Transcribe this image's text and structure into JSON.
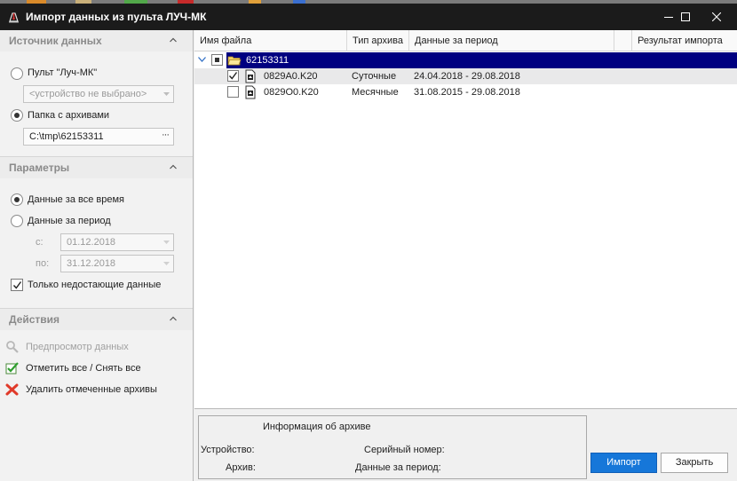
{
  "window": {
    "title": "Импорт данных из пульта ЛУЧ-МК",
    "icon": "pen-tool-icon",
    "controls": [
      "minimize-icon",
      "maximize-icon",
      "close-icon"
    ]
  },
  "left_panel": {
    "source": {
      "title": "Источник данных",
      "option_console_label": "Пульт \"Луч-МК\"",
      "option_console_checked": false,
      "device_placeholder": "<устройство не выбрано>",
      "option_folder_label": "Папка с архивами",
      "option_folder_checked": true,
      "folder_path": "C:\\tmp\\62153311",
      "browse_label": "···"
    },
    "params": {
      "title": "Параметры",
      "option_all_time_label": "Данные за все время",
      "option_all_time_checked": true,
      "option_period_label": "Данные за период",
      "option_period_checked": false,
      "from_label": "с:",
      "from_value": "01.12.2018",
      "to_label": "по:",
      "to_value": "31.12.2018",
      "only_missing_label": "Только недостающие данные",
      "only_missing_checked": true
    },
    "actions": {
      "title": "Действия",
      "items": [
        {
          "label": "Предпросмотр данных",
          "icon": "magnifier-icon",
          "enabled": false
        },
        {
          "label": "Отметить все / Снять все",
          "icon": "green-check-icon",
          "enabled": true
        },
        {
          "label": "Удалить отмеченные архивы",
          "icon": "red-x-icon",
          "enabled": true
        }
      ]
    }
  },
  "grid": {
    "columns": [
      "Имя файла",
      "Тип архива",
      "Данные за период",
      "",
      "Результат импорта"
    ],
    "rows": [
      {
        "name": "62153311",
        "type": "",
        "period": "",
        "result": "",
        "kind": "folder",
        "checkbox": "partial",
        "selected": true,
        "expanded": true
      },
      {
        "name": "0829A0.K20",
        "type": "Суточные",
        "period": "24.04.2018 - 29.08.2018",
        "result": "",
        "kind": "file",
        "checkbox": "checked"
      },
      {
        "name": "0829O0.K20",
        "type": "Месячные",
        "period": "31.08.2015 - 29.08.2018",
        "result": "",
        "kind": "file",
        "checkbox": "unchecked"
      }
    ]
  },
  "info": {
    "title": "Информация об архиве",
    "device_label": "Устройство:",
    "archive_label": "Архив:",
    "serial_label": "Серийный номер:",
    "period_label": "Данные за период:"
  },
  "buttons": {
    "import_label": "Импорт",
    "close_label": "Закрыть"
  },
  "colors": {
    "selected_row": "#000080",
    "primary_button": "#1677d9",
    "titlebar": "#1b1b1b"
  }
}
